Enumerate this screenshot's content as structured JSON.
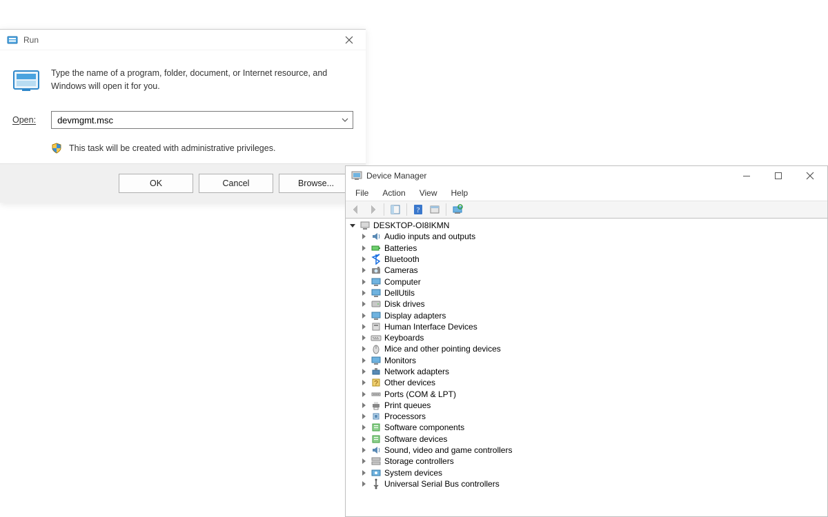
{
  "run_dialog": {
    "title": "Run",
    "message": "Type the name of a program, folder, document, or Internet resource, and Windows will open it for you.",
    "open_label": "Open:",
    "input_value": "devmgmt.msc",
    "admin_notice": "This task will be created with administrative privileges.",
    "buttons": {
      "ok": "OK",
      "cancel": "Cancel",
      "browse": "Browse..."
    }
  },
  "device_manager": {
    "title": "Device Manager",
    "menubar": [
      "File",
      "Action",
      "View",
      "Help"
    ],
    "root_node": "DESKTOP-OI8IKMN",
    "categories": [
      {
        "label": "Audio inputs and outputs",
        "icon": "audio"
      },
      {
        "label": "Batteries",
        "icon": "battery"
      },
      {
        "label": "Bluetooth",
        "icon": "bluetooth"
      },
      {
        "label": "Cameras",
        "icon": "camera"
      },
      {
        "label": "Computer",
        "icon": "monitor"
      },
      {
        "label": "DellUtils",
        "icon": "monitor"
      },
      {
        "label": "Disk drives",
        "icon": "disk"
      },
      {
        "label": "Display adapters",
        "icon": "monitor"
      },
      {
        "label": "Human Interface Devices",
        "icon": "hid"
      },
      {
        "label": "Keyboards",
        "icon": "keyboard"
      },
      {
        "label": "Mice and other pointing devices",
        "icon": "mouse"
      },
      {
        "label": "Monitors",
        "icon": "monitor"
      },
      {
        "label": "Network adapters",
        "icon": "net"
      },
      {
        "label": "Other devices",
        "icon": "other"
      },
      {
        "label": "Ports (COM & LPT)",
        "icon": "port"
      },
      {
        "label": "Print queues",
        "icon": "print"
      },
      {
        "label": "Processors",
        "icon": "cpu"
      },
      {
        "label": "Software components",
        "icon": "soft"
      },
      {
        "label": "Software devices",
        "icon": "soft"
      },
      {
        "label": "Sound, video and game controllers",
        "icon": "audio"
      },
      {
        "label": "Storage controllers",
        "icon": "storage"
      },
      {
        "label": "System devices",
        "icon": "system"
      },
      {
        "label": "Universal Serial Bus controllers",
        "icon": "usb"
      }
    ]
  }
}
